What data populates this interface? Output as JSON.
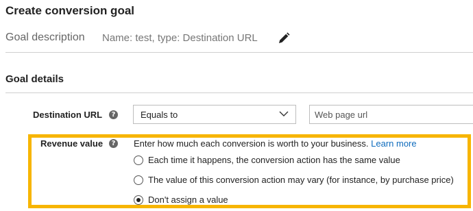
{
  "page": {
    "title": "Create conversion goal"
  },
  "goal_description": {
    "label": "Goal description",
    "value": "Name: test, type: Destination URL",
    "edit_icon": "pencil-icon"
  },
  "goal_details": {
    "heading": "Goal details",
    "destination_url": {
      "label": "Destination URL",
      "help_icon": "?",
      "operator_selected": "Equals to",
      "url_placeholder": "Web page url",
      "url_value": ""
    },
    "revenue_value": {
      "label": "Revenue value",
      "help_icon": "?",
      "description": "Enter how much each conversion is worth to your business.",
      "learn_more": "Learn more",
      "options": [
        {
          "label": "Each time it happens, the conversion action has the same value",
          "selected": false
        },
        {
          "label": "The value of this conversion action may vary (for instance, by purchase price)",
          "selected": false
        },
        {
          "label": "Don't assign a value",
          "selected": true
        }
      ]
    }
  },
  "colors": {
    "highlight": "#f7b500",
    "link": "#0f6cbd",
    "divider": "#cfcfcf"
  }
}
